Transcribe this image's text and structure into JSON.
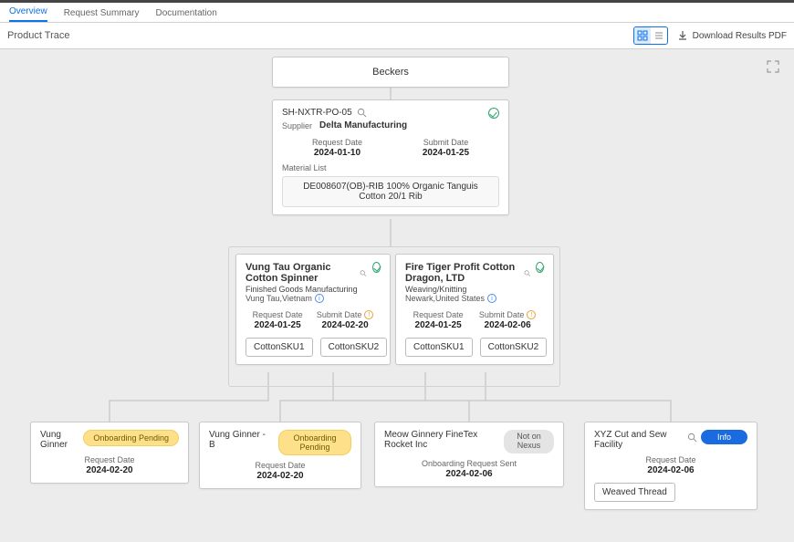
{
  "tabs": {
    "overview": "Overview",
    "summary": "Request Summary",
    "docs": "Documentation"
  },
  "page": {
    "title": "Product Trace",
    "download": "Download Results PDF"
  },
  "root": {
    "name": "Beckers"
  },
  "po": {
    "code": "SH-NXTR-PO-05",
    "supplier_label": "Supplier",
    "supplier": "Delta Manufacturing",
    "req_label": "Request Date",
    "req": "2024-01-10",
    "sub_label": "Submit Date",
    "sub": "2024-01-25",
    "mat_label": "Material List",
    "material": "DE008607(OB)-RIB 100% Organic Tanguis Cotton 20/1 Rib"
  },
  "sp1": {
    "name": "Vung Tau Organic Cotton Spinner",
    "role": "Finished Goods Manufacturing",
    "loc": "Vung Tau,Vietnam",
    "req_label": "Request Date",
    "req": "2024-01-25",
    "sub_label": "Submit Date",
    "sub": "2024-02-20",
    "sku1": "CottonSKU1",
    "sku2": "CottonSKU2"
  },
  "sp2": {
    "name": "Fire Tiger Profit Cotton Dragon, LTD",
    "role": "Weaving/Knitting",
    "loc": "Newark,United States",
    "req_label": "Request Date",
    "req": "2024-01-25",
    "sub_label": "Submit Date",
    "sub": "2024-02-06",
    "sku1": "CottonSKU1",
    "sku2": "CottonSKU2"
  },
  "lf1": {
    "name": "Vung Ginner",
    "badge": "Onboarding Pending",
    "req_label": "Request Date",
    "req": "2024-02-20"
  },
  "lf2": {
    "name": "Vung Ginner - B",
    "badge": "Onboarding Pending",
    "req_label": "Request Date",
    "req": "2024-02-20"
  },
  "lf3": {
    "name": "Meow Ginnery FineTex Rocket Inc",
    "badge": "Not on Nexus",
    "status": "Onboarding Request Sent",
    "req": "2024-02-06"
  },
  "lf4": {
    "name": "XYZ Cut and Sew Facility",
    "badge": "Info",
    "req_label": "Request Date",
    "req": "2024-02-06",
    "chip": "Weaved Thread"
  }
}
